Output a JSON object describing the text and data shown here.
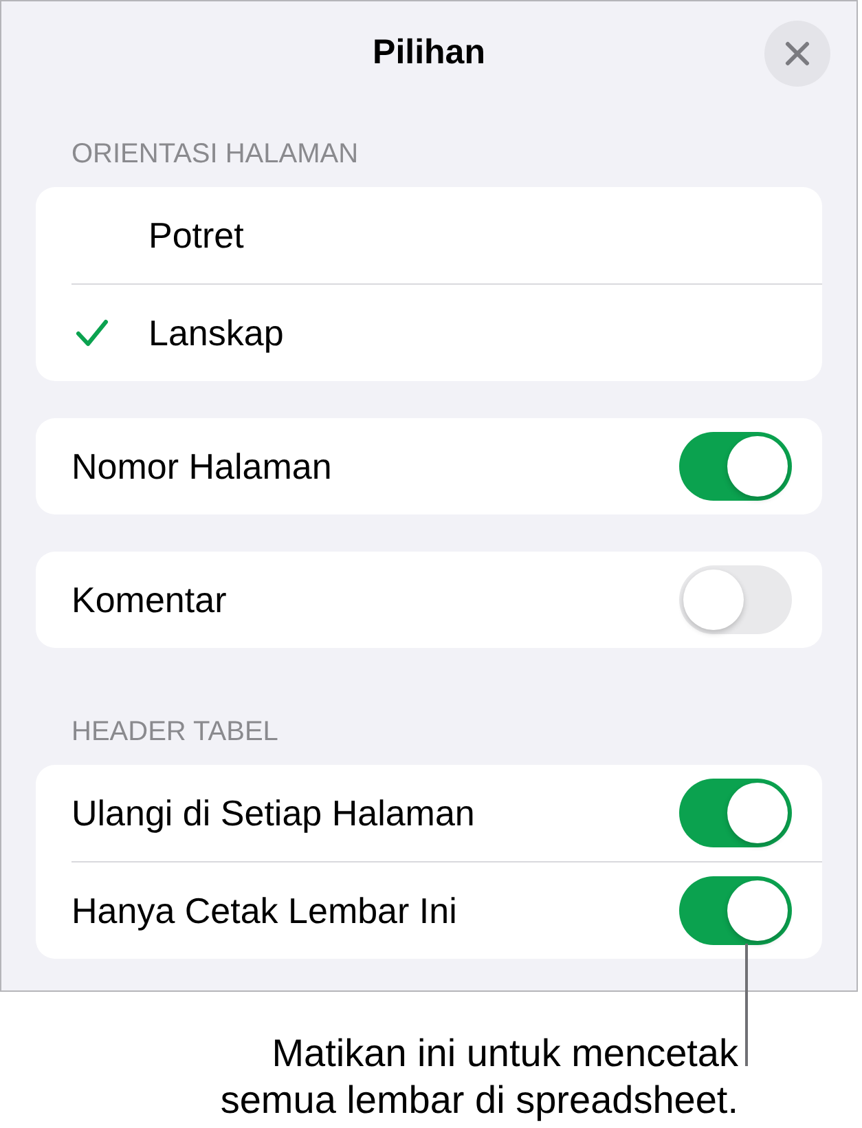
{
  "dialog": {
    "title": "Pilihan"
  },
  "groups": [
    {
      "header": "ORIENTASI HALAMAN",
      "kind": "choice",
      "rows": [
        {
          "label": "Potret",
          "selected": false
        },
        {
          "label": "Lanskap",
          "selected": true
        }
      ]
    },
    {
      "kind": "toggle",
      "rows": [
        {
          "label": "Nomor Halaman",
          "on": true
        }
      ]
    },
    {
      "kind": "toggle",
      "rows": [
        {
          "label": "Komentar",
          "on": false
        }
      ]
    },
    {
      "header": "HEADER TABEL",
      "kind": "toggle",
      "rows": [
        {
          "label": "Ulangi di Setiap Halaman",
          "on": true
        },
        {
          "label": "Hanya Cetak Lembar Ini",
          "on": true
        }
      ]
    }
  ],
  "callout": {
    "text": "Matikan ini untuk mencetak semua lembar di spreadsheet."
  }
}
